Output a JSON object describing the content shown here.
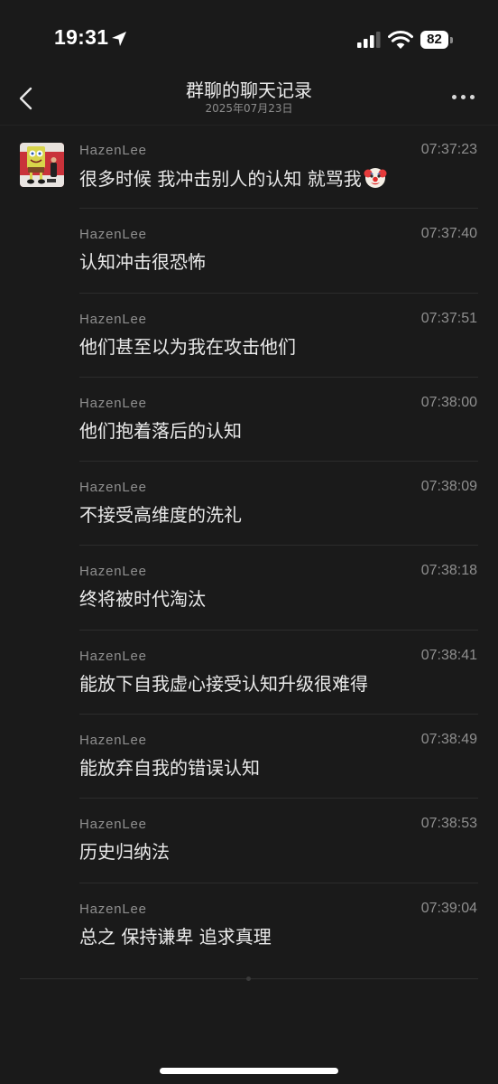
{
  "status_bar": {
    "time": "19:31",
    "location_icon": "location-arrow-icon",
    "signal_icon": "cellular-signal-icon",
    "wifi_icon": "wifi-icon",
    "battery_level": "82"
  },
  "header": {
    "title": "群聊的聊天记录",
    "subtitle": "2025年07月23日",
    "back_icon": "chevron-left-icon",
    "more_icon": "more-dots-icon"
  },
  "messages": [
    {
      "sender": "HazenLee",
      "time": "07:37:23",
      "text": "很多时候 我冲击别人的认知 就骂我",
      "emoji": "clown-face-icon"
    },
    {
      "sender": "HazenLee",
      "time": "07:37:40",
      "text": "认知冲击很恐怖"
    },
    {
      "sender": "HazenLee",
      "time": "07:37:51",
      "text": "他们甚至以为我在攻击他们"
    },
    {
      "sender": "HazenLee",
      "time": "07:38:00",
      "text": "他们抱着落后的认知"
    },
    {
      "sender": "HazenLee",
      "time": "07:38:09",
      "text": "不接受高维度的洗礼"
    },
    {
      "sender": "HazenLee",
      "time": "07:38:18",
      "text": "终将被时代淘汰"
    },
    {
      "sender": "HazenLee",
      "time": "07:38:41",
      "text": "能放下自我虚心接受认知升级很难得"
    },
    {
      "sender": "HazenLee",
      "time": "07:38:49",
      "text": "能放弃自我的错误认知"
    },
    {
      "sender": "HazenLee",
      "time": "07:38:53",
      "text": "历史归纳法"
    },
    {
      "sender": "HazenLee",
      "time": "07:39:04",
      "text": "总之 保持谦卑 追求真理"
    }
  ],
  "colors": {
    "background": "#1a1a1a",
    "text_primary": "#e9e9e9",
    "text_secondary": "#8f8f8f",
    "divider": "#2c2c2c"
  }
}
